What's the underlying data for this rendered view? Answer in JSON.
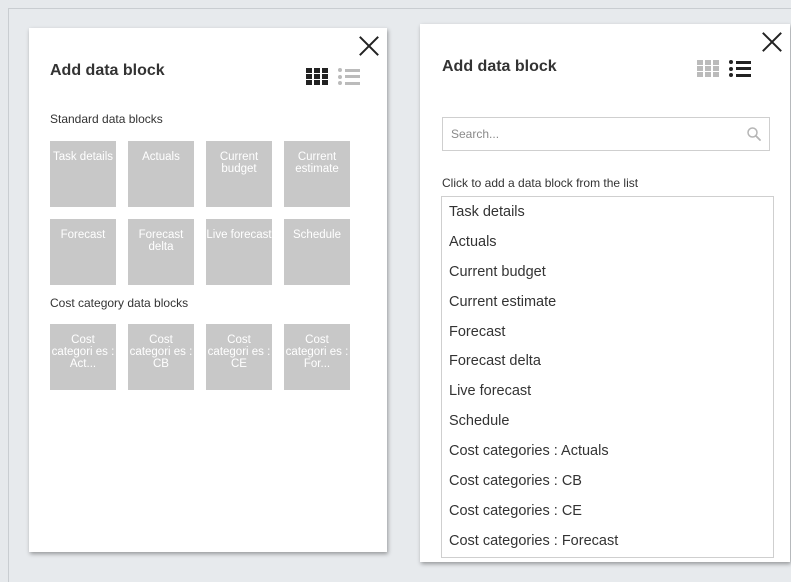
{
  "grid_panel": {
    "title": "Add data block",
    "standard_label": "Standard data blocks",
    "standard_tiles": [
      "Task details",
      "Actuals",
      "Current budget",
      "Current estimate",
      "Forecast",
      "Forecast delta",
      "Live forecast",
      "Schedule"
    ],
    "cost_label": "Cost category data blocks",
    "cost_tiles": [
      "Cost categori es : Act...",
      "Cost categori es : CB",
      "Cost categori es : CE",
      "Cost categori es : For..."
    ]
  },
  "list_panel": {
    "title": "Add data block",
    "search_placeholder": "Search...",
    "hint": "Click to add a data block from the list",
    "items": [
      "Task details",
      "Actuals",
      "Current budget",
      "Current estimate",
      "Forecast",
      "Forecast delta",
      "Live forecast",
      "Schedule",
      "Cost categories : Actuals",
      "Cost categories : CB",
      "Cost categories : CE",
      "Cost categories : Forecast"
    ]
  },
  "colors": {
    "tile_bg": "#c8c8c8",
    "page_bg": "#e6e9ec",
    "active_icon": "#222222",
    "inactive_icon": "#bbbbbb"
  },
  "icons": [
    "close-icon",
    "grid-view-icon",
    "list-view-icon",
    "search-icon"
  ]
}
